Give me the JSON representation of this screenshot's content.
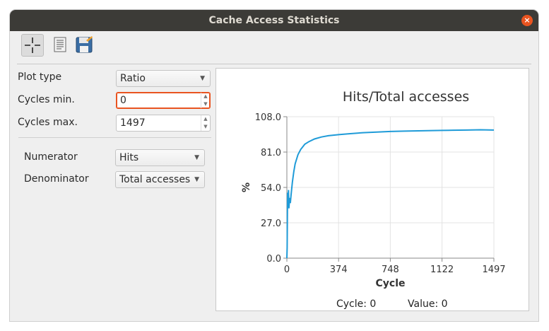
{
  "window": {
    "title": "Cache Access Statistics",
    "close": "×"
  },
  "toolbar": {
    "icons": [
      "crosshair-icon",
      "document-icon",
      "save-icon"
    ]
  },
  "form": {
    "plot_type_label": "Plot type",
    "plot_type_value": "Ratio",
    "cycles_min_label": "Cycles min.",
    "cycles_min_value": "0",
    "cycles_max_label": "Cycles max.",
    "cycles_max_value": "1497",
    "numerator_label": "Numerator",
    "numerator_value": "Hits",
    "denominator_label": "Denominator",
    "denominator_value": "Total accesses"
  },
  "status": {
    "cycle_text": "Cycle: 0",
    "value_text": "Value: 0"
  },
  "colors": {
    "accent": "#e95420",
    "series": "#1f9bd8",
    "titlebar": "#3c3b37"
  },
  "chart_data": {
    "type": "line",
    "title": "Hits/Total accesses",
    "xlabel": "Cycle",
    "ylabel": "%",
    "xlim": [
      0,
      1497
    ],
    "ylim": [
      0,
      108
    ],
    "xticks": [
      0,
      374,
      748,
      1122,
      1497
    ],
    "yticks": [
      0,
      27,
      54,
      81,
      108
    ],
    "ytick_labels": [
      "0.0",
      "27.0",
      "54.0",
      "81.0",
      "108.0"
    ],
    "grid": true,
    "series": [
      {
        "x": [
          0,
          2,
          5,
          8,
          12,
          15,
          20,
          25,
          30,
          40,
          50,
          60,
          80,
          100,
          130,
          160,
          200,
          250,
          300,
          374,
          450,
          550,
          650,
          748,
          850,
          950,
          1050,
          1122,
          1200,
          1300,
          1400,
          1497
        ],
        "y": [
          0,
          8,
          50,
          40,
          52,
          38,
          46,
          42,
          48,
          58,
          66,
          72,
          79,
          83,
          87,
          89,
          91,
          92.5,
          93.5,
          94.3,
          95,
          95.8,
          96.3,
          96.7,
          97,
          97.2,
          97.4,
          97.5,
          97.7,
          97.8,
          98,
          97.8
        ]
      }
    ]
  }
}
